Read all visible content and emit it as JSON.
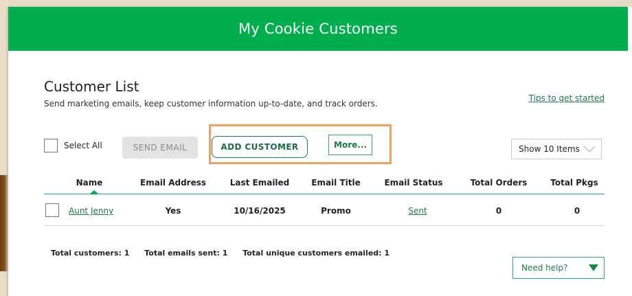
{
  "header": {
    "title": "My Cookie Customers"
  },
  "page": {
    "title": "Customer List",
    "subtitle": "Send marketing emails, keep customer information up-to-date, and track orders.",
    "tips_link": "Tips to get started"
  },
  "toolbar": {
    "select_all_label": "Select All",
    "send_email_label": "SEND EMAIL",
    "add_customer_label": "ADD CUSTOMER",
    "more_label": "More...",
    "show_items_label": "Show 10 Items"
  },
  "table": {
    "columns": [
      "Name",
      "Email Address",
      "Last Emailed",
      "Email Title",
      "Email Status",
      "Total Orders",
      "Total Pkgs"
    ],
    "rows": [
      {
        "name": "Aunt Jenny",
        "email": "Yes",
        "last_emailed": "10/16/2025",
        "email_title": "Promo",
        "email_status": "Sent",
        "total_orders": "0",
        "total_pkgs": "0"
      }
    ]
  },
  "footer": {
    "total_customers": "Total customers: 1",
    "total_emails_sent": "Total emails sent: 1",
    "total_unique": "Total unique customers emailed: 1",
    "help_label": "Need help?"
  },
  "colors": {
    "brand_green": "#00ae4e",
    "highlight_orange": "#f0a060",
    "link_green": "#1c7a47"
  },
  "icons": {
    "show_select": "chevron-down-icon",
    "help": "triangle-down-icon"
  }
}
